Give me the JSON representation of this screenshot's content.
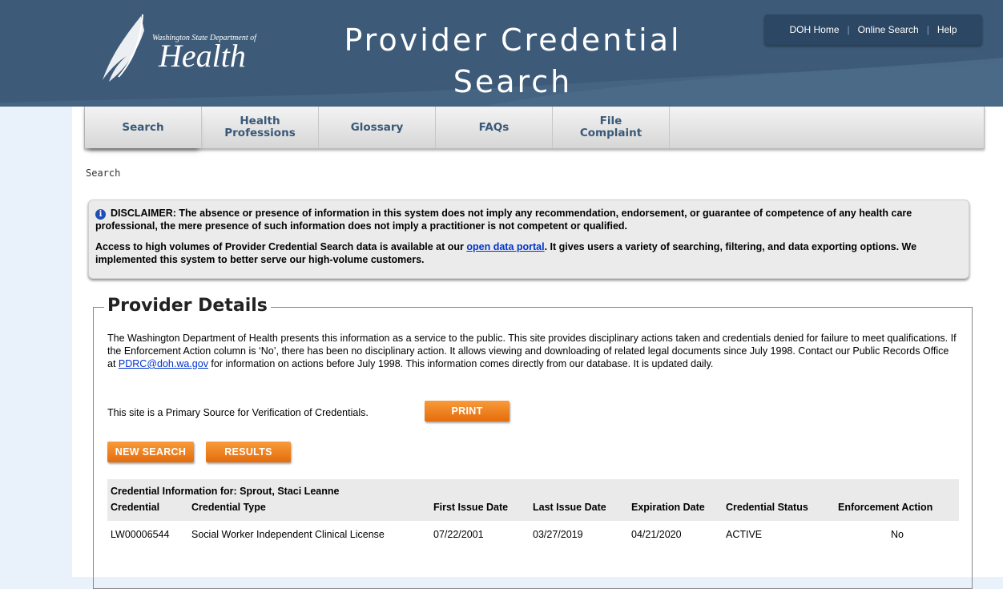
{
  "header": {
    "logo_small": "Washington State Department of",
    "logo_big": "Health",
    "title_line1": "Provider Credential",
    "title_line2": "Search",
    "utility_nav": [
      "DOH Home",
      "Online Search",
      "Help"
    ]
  },
  "tabs": [
    "Search",
    "Health Professions",
    "Glossary",
    "FAQs",
    "File Complaint"
  ],
  "breadcrumb": "Search",
  "disclaimer": {
    "icon": "info-icon",
    "p1": "DISCLAIMER: The absence or presence of information in this system does not imply any recommendation, endorsement, or guarantee of competence of any health care professional, the mere presence of such information does not imply a practitioner is not competent or qualified.",
    "p2_before": "Access to high volumes of Provider Credential Search data is available at our ",
    "p2_link": "open data portal",
    "p2_after": ". It gives users a variety of searching, filtering, and data exporting options. We implemented this system to better serve our high-volume customers."
  },
  "details": {
    "legend": "Provider Details",
    "intro_before": "The Washington Department of Health presents this information as a service to the public. This site provides disciplinary actions taken and credentials denied for failure to meet qualifications. If the Enforcement Action column is ‘No’, there has been no disciplinary action. It allows viewing and downloading of related legal documents since July 1998. Contact our Public Records Office at ",
    "intro_link": "PDRC@doh.wa.gov",
    "intro_after": " for information on actions before July 1998. This information comes directly from our database. It is updated daily.",
    "primary_source": "This site is a Primary Source for Verification of Credentials.",
    "print_label": "PRINT",
    "new_search_label": "NEW SEARCH",
    "results_label": "RESULTS"
  },
  "credentials": {
    "caption": "Credential Information for: Sprout, Staci Leanne",
    "columns": [
      "Credential",
      "Credential Type",
      "First Issue Date",
      "Last Issue Date",
      "Expiration Date",
      "Credential Status",
      "Enforcement Action"
    ],
    "rows": [
      [
        "LW00006544",
        "Social Worker Independent Clinical License",
        "07/22/2001",
        "03/27/2019",
        "04/21/2020",
        "ACTIVE",
        "No"
      ]
    ]
  },
  "colors": {
    "header_bg": "#3d5b79",
    "tab_text": "#3a5878",
    "button_orange": "#f08424",
    "page_bg": "#e9f1fa"
  }
}
